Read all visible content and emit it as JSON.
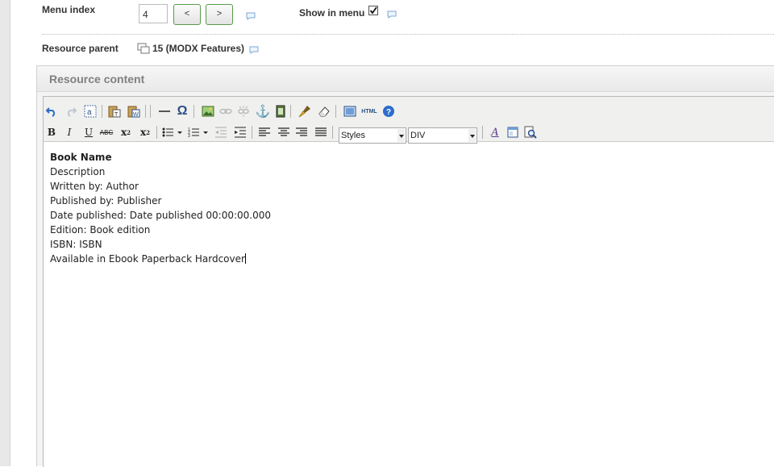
{
  "menu_index": {
    "label": "Menu index",
    "value": "4",
    "decrement_label": "<",
    "increment_label": ">"
  },
  "show_in_menu": {
    "label": "Show in menu",
    "checked": true
  },
  "resource_parent": {
    "label": "Resource parent",
    "value": "15 (MODX Features)"
  },
  "resource_content": {
    "title": "Resource content",
    "toolbar": {
      "row1": [
        "undo-icon",
        "redo-icon",
        "select-all-icon",
        "paste-text-icon",
        "paste-word-icon",
        "horizontal-rule-icon",
        "special-char-icon",
        "insert-image-icon",
        "insert-link-icon",
        "unlink-icon",
        "anchor-icon",
        "media-icon",
        "cleanup-icon",
        "remove-format-icon",
        "visual-aid-icon",
        "html-source-icon",
        "help-icon"
      ],
      "row2": [
        "bold-icon",
        "italic-icon",
        "underline-icon",
        "strikethrough-icon",
        "subscript-icon",
        "superscript-icon",
        "bullet-list-icon",
        "numbered-list-icon",
        "outdent-icon",
        "indent-icon",
        "align-left-icon",
        "align-center-icon",
        "align-right-icon",
        "justify-icon",
        "text-style-icon",
        "template-icon",
        "preview-icon"
      ],
      "styles_select": "Styles",
      "format_select": "DIV",
      "html_label": "HTML"
    },
    "lines": [
      "Book Name",
      "Description",
      "Written by: Author",
      "Published by: Publisher",
      "Date published: Date published 00:00:00.000",
      "Edition: Book edition",
      "ISBN: ISBN",
      "Available in Ebook Paperback Hardcover"
    ]
  }
}
